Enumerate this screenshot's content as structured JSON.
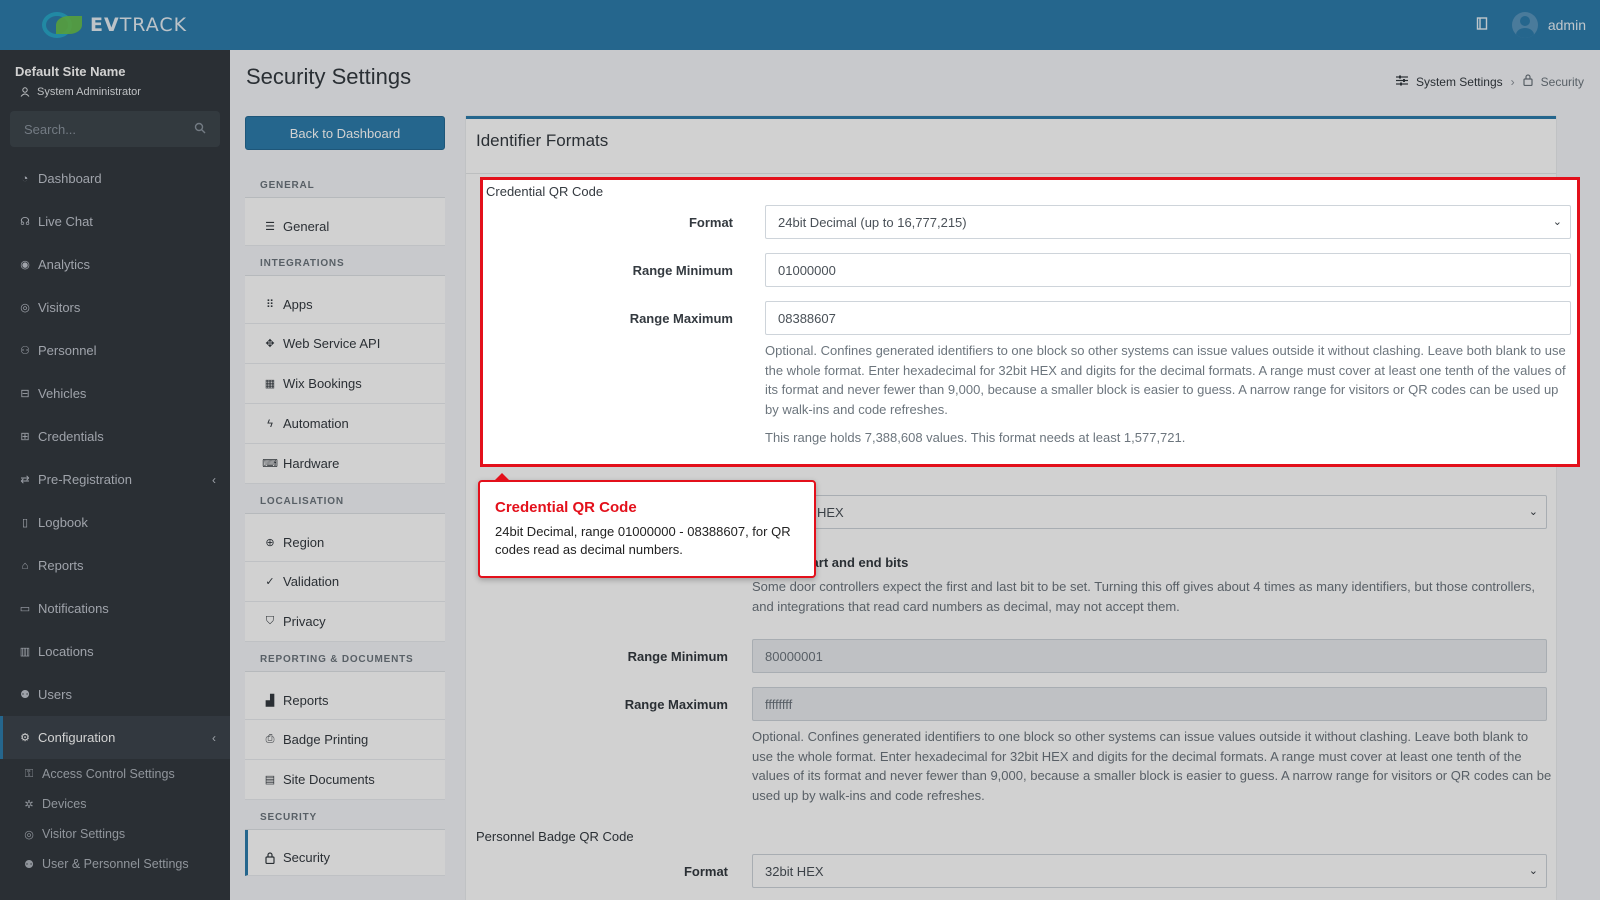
{
  "brand": {
    "name_bold": "EV",
    "name_rest": "TRACK"
  },
  "topbar": {
    "book_icon": "book-icon",
    "user_name": "admin"
  },
  "sidebar": {
    "site_name": "Default Site Name",
    "role": "System Administrator",
    "search_placeholder": "Search...",
    "items": [
      {
        "label": "Dashboard",
        "icon": "dashboard-icon"
      },
      {
        "label": "Live Chat",
        "icon": "headset-icon"
      },
      {
        "label": "Analytics",
        "icon": "analytics-icon"
      },
      {
        "label": "Visitors",
        "icon": "eye-icon"
      },
      {
        "label": "Personnel",
        "icon": "personnel-icon"
      },
      {
        "label": "Vehicles",
        "icon": "car-icon"
      },
      {
        "label": "Credentials",
        "icon": "credentials-icon"
      },
      {
        "label": "Pre-Registration",
        "icon": "exchange-icon"
      },
      {
        "label": "Logbook",
        "icon": "logbook-icon"
      },
      {
        "label": "Reports",
        "icon": "reports-icon"
      },
      {
        "label": "Notifications",
        "icon": "notifications-icon"
      },
      {
        "label": "Locations",
        "icon": "map-icon"
      },
      {
        "label": "Users",
        "icon": "users-icon"
      },
      {
        "label": "Configuration",
        "icon": "gear-icon"
      }
    ],
    "sub_items": [
      {
        "label": "Access Control Settings",
        "icon": "key-icon"
      },
      {
        "label": "Devices",
        "icon": "cog-icon"
      },
      {
        "label": "Visitor Settings",
        "icon": "eye-icon"
      },
      {
        "label": "User & Personnel Settings",
        "icon": "users-icon"
      }
    ]
  },
  "page": {
    "title": "Security Settings",
    "breadcrumb": {
      "parent": "System Settings",
      "current": "Security"
    },
    "back_button": "Back to Dashboard"
  },
  "settings_nav": {
    "general_header": "GENERAL",
    "general": [
      "General"
    ],
    "integrations_header": "INTEGRATIONS",
    "integrations": [
      "Apps",
      "Web Service API",
      "Wix Bookings",
      "Automation",
      "Hardware"
    ],
    "localisation_header": "LOCALISATION",
    "localisation": [
      "Region",
      "Validation",
      "Privacy"
    ],
    "reporting_header": "REPORTING & DOCUMENTS",
    "reporting": [
      "Reports",
      "Badge Printing",
      "Site Documents"
    ],
    "security_header": "SECURITY",
    "security": [
      "Security"
    ]
  },
  "card": {
    "title": "Identifier Formats",
    "credential_qr": {
      "section": "Credential QR Code",
      "format_label": "Format",
      "format_value": "24bit Decimal (up to 16,777,215)",
      "min_label": "Range Minimum",
      "min_value": "01000000",
      "max_label": "Range Maximum",
      "max_value": "08388607",
      "help": "Optional. Confines generated identifiers to one block so other systems can issue values outside it without clashing. Leave both blank to use the whole format. Enter hexadecimal for 32bit HEX and digits for the decimal formats. A range must cover at least one tenth of the values of its format and never fewer than 9,000, because a smaller block is easier to guess. A narrow range for visitors or QR codes can be used up by walk-ins and code refreshes.",
      "range_info": "This range holds 7,388,608 values. This format needs at least 1,577,721."
    },
    "second": {
      "format_partial": "HEX",
      "switch_partial": "start and end bits",
      "switch_help": "Some door controllers expect the first and last bit to be set. Turning this off gives about 4 times as many identifiers, but those controllers, and integrations that read card numbers as decimal, may not accept them.",
      "min_label": "Range Minimum",
      "min_placeholder": "80000001",
      "max_label": "Range Maximum",
      "max_placeholder": "ffffffff",
      "help": "Optional. Confines generated identifiers to one block so other systems can issue values outside it without clashing. Leave both blank to use the whole format. Enter hexadecimal for 32bit HEX and digits for the decimal formats. A range must cover at least one tenth of the values of its format and never fewer than 9,000, because a smaller block is easier to guess. A narrow range for visitors or QR codes can be used up by walk-ins and code refreshes."
    },
    "personnel_qr": {
      "section": "Personnel Badge QR Code",
      "format_label": "Format",
      "format_value": "32bit HEX"
    }
  },
  "tooltip": {
    "title": "Credential QR Code",
    "body": "24bit Decimal, range 01000000 - 08388607, for QR codes read as decimal numbers."
  },
  "colors": {
    "accent": "#2e7dad",
    "sidebar_bg": "#343a40",
    "highlight": "#e3101b"
  }
}
